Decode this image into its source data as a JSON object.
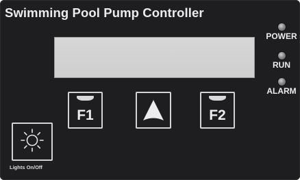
{
  "panel": {
    "title": "Swimming Pool Pump Controller"
  },
  "display": {
    "text": ""
  },
  "indicators": [
    {
      "label": "POWER",
      "icon": "led-indicator-icon"
    },
    {
      "label": "RUN",
      "icon": "led-indicator-icon"
    },
    {
      "label": "ALARM",
      "icon": "led-indicator-icon"
    }
  ],
  "buttons": {
    "f1_label": "F1",
    "f2_label": "F2",
    "up_icon": "up-arrow-icon"
  },
  "lights": {
    "label": "Lights On/Off",
    "icon": "sun-icon"
  },
  "colors": {
    "panel": "#1e1e20",
    "text": "#ececec",
    "display": "#d3d3d3",
    "led": "#8a8a8a"
  }
}
